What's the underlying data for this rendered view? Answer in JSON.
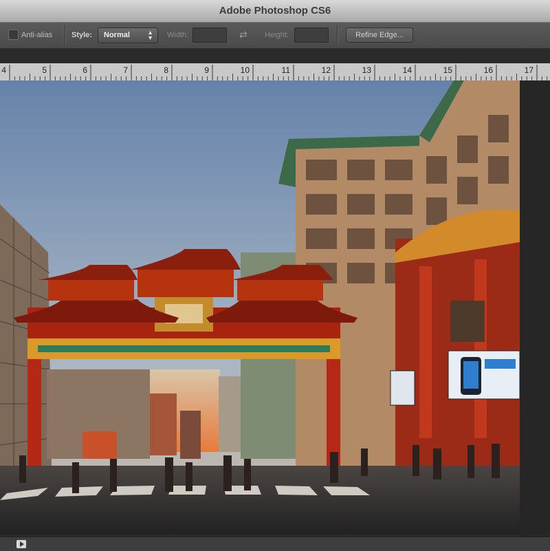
{
  "app": {
    "title": "Adobe Photoshop CS6"
  },
  "options_bar": {
    "anti_alias_label": "Anti-alias",
    "style_label": "Style:",
    "style_value": "Normal",
    "width_label": "Width:",
    "height_label": "Height:",
    "refine_edge_label": "Refine Edge...",
    "swap_icon": "swap-arrows-icon"
  },
  "ruler": {
    "labels": [
      "4",
      "5",
      "6",
      "7",
      "8",
      "9",
      "10",
      "11",
      "12",
      "13",
      "14",
      "15",
      "16",
      "17"
    ]
  },
  "colors": {
    "sky_top": "#5f7ea8",
    "sky_bottom": "#b9c3cc",
    "gate_red": "#a8240f",
    "gate_gold": "#d99a2a",
    "building_tan": "#b98a5e",
    "roof_green": "#3c6a48"
  }
}
